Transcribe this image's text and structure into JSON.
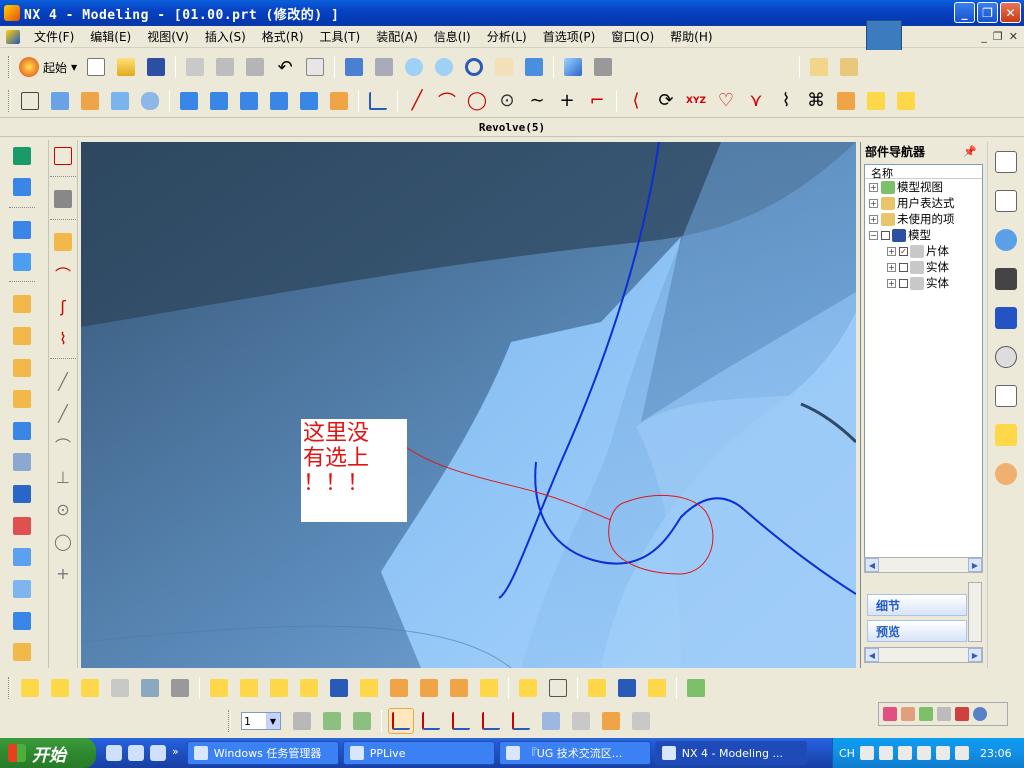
{
  "window": {
    "title": "NX 4 - Modeling - [01.00.prt  (修改的) ]",
    "min_label": "_",
    "max_label": "❐",
    "close_label": "✕"
  },
  "menu": {
    "items": [
      "文件(F)",
      "编辑(E)",
      "视图(V)",
      "插入(S)",
      "格式(R)",
      "工具(T)",
      "装配(A)",
      "信息(I)",
      "分析(L)",
      "首选项(P)",
      "窗口(O)",
      "帮助(H)"
    ]
  },
  "toolbar": {
    "start_label": "起始",
    "more": "»"
  },
  "prompt": {
    "text": "Revolve(5)"
  },
  "viewport": {
    "annotation_lines": [
      "这里没",
      "有选上",
      "！！！"
    ]
  },
  "part_navigator": {
    "title": "部件导航器",
    "column_name": "名称",
    "tree": [
      {
        "label": "模型视图",
        "expander": "+"
      },
      {
        "label": "用户表达式",
        "expander": "+"
      },
      {
        "label": "未使用的项",
        "expander": "+"
      },
      {
        "label": "模型",
        "expander": "−"
      },
      {
        "label": "片体",
        "expander": "+",
        "checked": true
      },
      {
        "label": "实体",
        "expander": "+",
        "checked": false
      },
      {
        "label": "实体",
        "expander": "+",
        "checked": false
      }
    ],
    "details_label": "细节",
    "preview_label": "预览"
  },
  "bottom_toolbar": {
    "layer_value": "1"
  },
  "taskbar": {
    "start_label": "开始",
    "tasks": [
      {
        "label": "Windows 任务管理器"
      },
      {
        "label": "PPLive"
      },
      {
        "label": "『UG 技术交流区..."
      },
      {
        "label": "NX 4 - Modeling ..."
      }
    ],
    "lang": "CH",
    "clock": "23:06"
  },
  "colors": {
    "viewport_bg": "#33506b",
    "surface_light": "#8ec3f5",
    "curve_blue": "#0b2fd6",
    "annotation_red": "#e21313"
  }
}
